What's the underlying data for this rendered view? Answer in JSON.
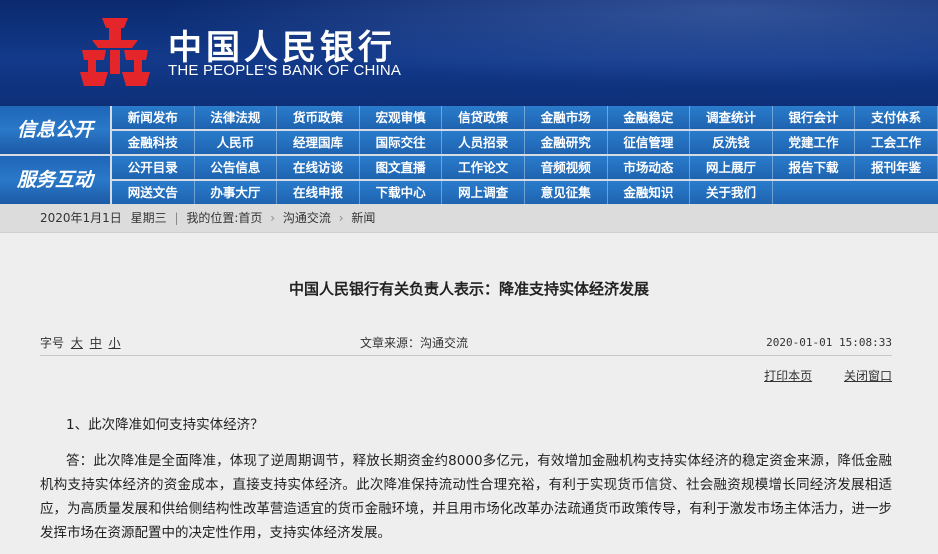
{
  "header": {
    "name_cn": "中国人民银行",
    "name_en": "THE PEOPLE'S BANK OF CHINA",
    "logo_color": "#e4262b"
  },
  "nav": {
    "public": {
      "label": "信息公开",
      "rows": [
        [
          "新闻发布",
          "法律法规",
          "货币政策",
          "宏观审慎",
          "信贷政策",
          "金融市场",
          "金融稳定",
          "调查统计",
          "银行会计",
          "支付体系"
        ],
        [
          "金融科技",
          "人民币",
          "经理国库",
          "国际交往",
          "人员招录",
          "金融研究",
          "征信管理",
          "反洗钱",
          "党建工作",
          "工会工作"
        ]
      ]
    },
    "service": {
      "label": "服务互动",
      "rows": [
        [
          "公开目录",
          "公告信息",
          "在线访谈",
          "图文直播",
          "工作论文",
          "音频视频",
          "市场动态",
          "网上展厅",
          "报告下载",
          "报刊年鉴"
        ],
        [
          "网送文告",
          "办事大厅",
          "在线申报",
          "下载中心",
          "网上调查",
          "意见征集",
          "金融知识",
          "关于我们"
        ]
      ]
    }
  },
  "breadcrumb": {
    "date": "2020年1月1日",
    "weekday": "星期三",
    "location_label": "我的位置:",
    "items": [
      "首页",
      "沟通交流",
      "新闻"
    ],
    "sep": "›"
  },
  "article": {
    "title": "中国人民银行有关负责人表示：降准支持实体经济发展",
    "fontsize_label": "字号",
    "fontsize_options": [
      "大",
      "中",
      "小"
    ],
    "source": "文章来源：沟通交流",
    "datetime": "2020-01-01  15:08:33",
    "print_label": "打印本页",
    "close_label": "关闭窗口",
    "question": "1、此次降准如何支持实体经济？",
    "answer": "答：此次降准是全面降准，体现了逆周期调节，释放长期资金约8000多亿元，有效增加金融机构支持实体经济的稳定资金来源，降低金融机构支持实体经济的资金成本，直接支持实体经济。此次降准保持流动性合理充裕，有利于实现货币信贷、社会融资规模增长同经济发展相适应，为高质量发展和供给侧结构性改革营造适宜的货币金融环境，并且用市场化改革办法疏通货币政策传导，有利于激发市场主体活力，进一步发挥市场在资源配置中的决定性作用，支持实体经济发展。"
  }
}
